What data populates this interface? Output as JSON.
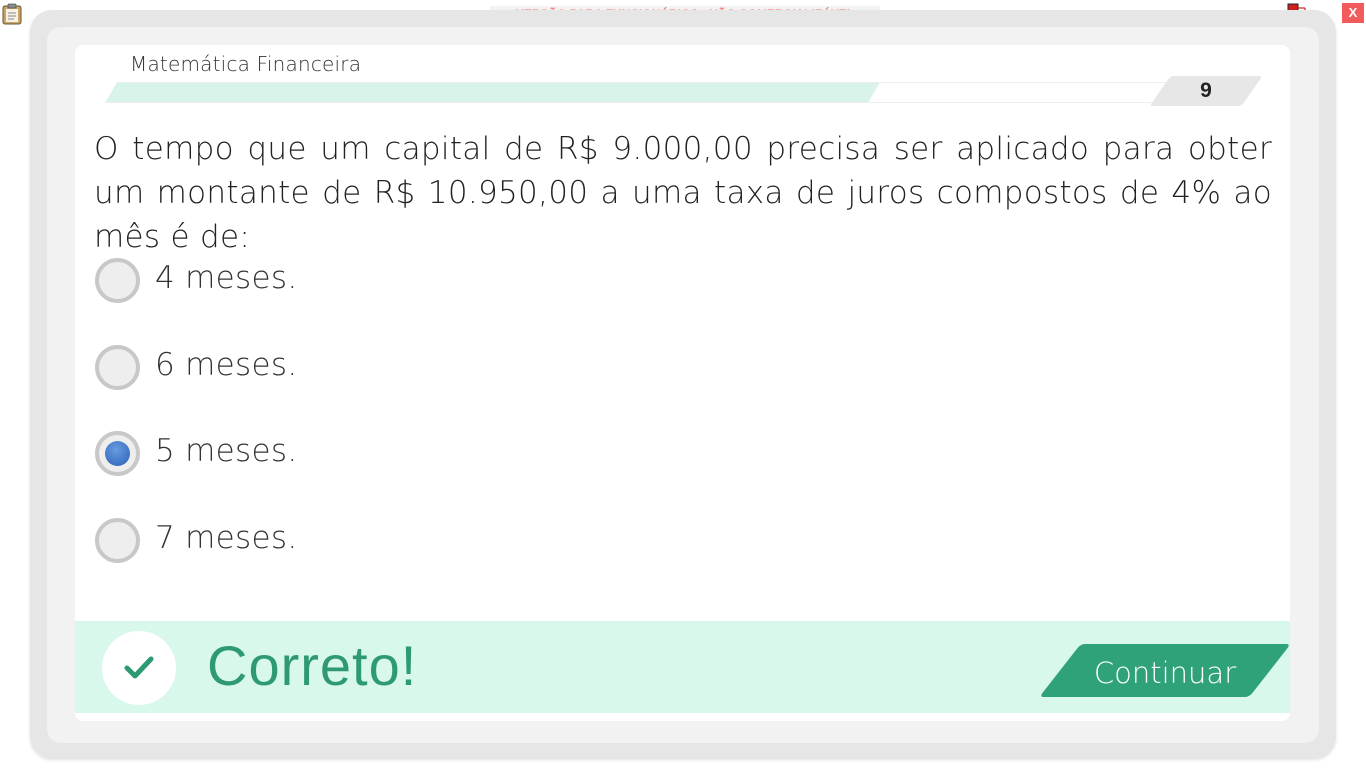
{
  "toolbar": {
    "watermark": "VERSÃO PARA FUNCIONÁRIOS - NÃO COMERCIALIZÁVEL",
    "close_label": "X"
  },
  "quiz": {
    "subject": "Matemática Financeira",
    "question_number": "9",
    "progress_fraction": 0.72,
    "question": "O tempo que um capital de R$ 9.000,00 precisa ser aplicado para obter um montante de R$ 10.950,00 a uma taxa de juros compostos de 4% ao mês é de:",
    "options": [
      {
        "label": "4 meses.",
        "selected": false
      },
      {
        "label": "6 meses.",
        "selected": false
      },
      {
        "label": "5 meses.",
        "selected": true
      },
      {
        "label": "7 meses.",
        "selected": false
      }
    ]
  },
  "feedback": {
    "status": "Correto!",
    "continue_label": "Continuar"
  },
  "colors": {
    "accent": "#2fa27a",
    "feedback_bg": "#d8f8ec",
    "progress_fill": "#d8f3ea",
    "watermark_text": "#f26d6d",
    "close_bg": "#f25b5b",
    "radio_selected": "#2a5fb6"
  },
  "icons": {
    "clipboard": "clipboard-icon",
    "network": "network-icon",
    "check": "check-icon"
  }
}
